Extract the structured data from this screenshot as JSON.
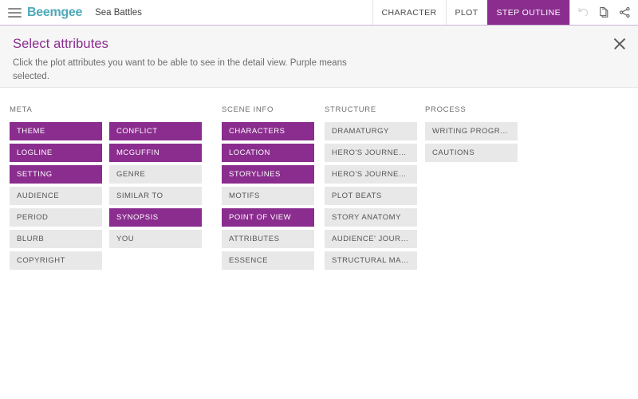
{
  "topbar": {
    "menu_icon": "hamburger-menu-icon",
    "brand": "Beemgee",
    "document_title": "Sea Battles",
    "tabs": [
      {
        "label": "CHARACTER",
        "active": false
      },
      {
        "label": "PLOT",
        "active": false
      },
      {
        "label": "STEP OUTLINE",
        "active": true
      }
    ],
    "icons": [
      {
        "name": "undo-icon",
        "disabled": true
      },
      {
        "name": "copy-document-icon",
        "disabled": false
      },
      {
        "name": "share-icon",
        "disabled": false
      }
    ]
  },
  "panel": {
    "title": "Select attributes",
    "subtitle": "Click the plot attributes you want to be able to see in the detail view. Purple means selected.",
    "close_label": "close-icon"
  },
  "colors": {
    "accent_purple": "#8a2d8e",
    "brand_teal": "#4fa8b8",
    "chip_gray": "#e8e8e8",
    "chip_text": "#555555",
    "panel_bg": "#f6f6f6"
  },
  "groups": [
    {
      "title": "META",
      "columns": [
        [
          {
            "label": "THEME",
            "selected": true
          },
          {
            "label": "LOGLINE",
            "selected": true
          },
          {
            "label": "SETTING",
            "selected": true
          },
          {
            "label": "AUDIENCE",
            "selected": false
          },
          {
            "label": "PERIOD",
            "selected": false
          },
          {
            "label": "BLURB",
            "selected": false
          },
          {
            "label": "COPYRIGHT",
            "selected": false
          }
        ],
        [
          {
            "label": "CONFLICT",
            "selected": true
          },
          {
            "label": "MCGUFFIN",
            "selected": true
          },
          {
            "label": "GENRE",
            "selected": false
          },
          {
            "label": "SIMILAR TO",
            "selected": false
          },
          {
            "label": "SYNOPSIS",
            "selected": true
          },
          {
            "label": "YOU",
            "selected": false
          }
        ]
      ]
    },
    {
      "title": "SCENE INFO",
      "columns": [
        [
          {
            "label": "CHARACTERS",
            "selected": true
          },
          {
            "label": "LOCATION",
            "selected": true
          },
          {
            "label": "STORYLINES",
            "selected": true
          },
          {
            "label": "MOTIFS",
            "selected": false
          },
          {
            "label": "POINT OF VIEW",
            "selected": true
          },
          {
            "label": "ATTRIBUTES",
            "selected": false
          },
          {
            "label": "ESSENCE",
            "selected": false
          }
        ]
      ]
    },
    {
      "title": "STRUCTURE",
      "columns": [
        [
          {
            "label": "DRAMATURGY",
            "selected": false
          },
          {
            "label": "HERO'S JOURNEY (NEW)",
            "selected": false
          },
          {
            "label": "HERO'S JOURNEY (CLASSIC)",
            "selected": false
          },
          {
            "label": "PLOT BEATS",
            "selected": false
          },
          {
            "label": "STORY ANATOMY",
            "selected": false
          },
          {
            "label": "AUDIENCE' JOURNEY",
            "selected": false
          },
          {
            "label": "STRUCTURAL MARKERS",
            "selected": false
          }
        ]
      ]
    },
    {
      "title": "PROCESS",
      "columns": [
        [
          {
            "label": "WRITING PROGRESS",
            "selected": false
          },
          {
            "label": "CAUTIONS",
            "selected": false
          }
        ]
      ]
    }
  ]
}
